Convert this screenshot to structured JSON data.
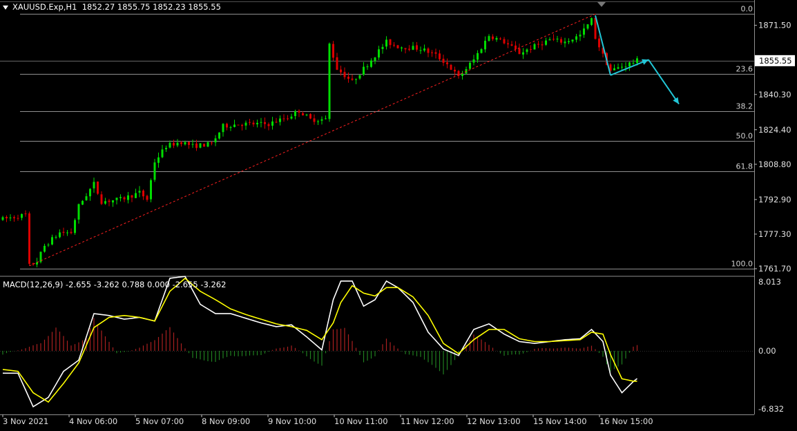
{
  "header": {
    "symbol": "XAUUSD.Exp,H1",
    "ohlc": "1852.27 1855.75 1852.23 1855.55"
  },
  "macd_header": {
    "label": "MACD(12,26,9) -2.655 -3.262 0.788 0.000 -2.655 -3.262"
  },
  "colors": {
    "background": "#000000",
    "bull": "#00dd00",
    "bear": "#dd0000",
    "grid": "#c0c0c0",
    "trendline": "#ff2020",
    "arrow": "#22c6d6",
    "macd_main": "#ffffff",
    "macd_signal": "#ffff00",
    "hist_up": "#aa2020",
    "hist_down": "#208020",
    "current_price_bg": "#ffffff"
  },
  "chart_data": [
    {
      "type": "candlestick",
      "name": "XAUUSD.Exp H1",
      "ylim": [
        1761.7,
        1877.0
      ],
      "y_ticks": [
        "1871.50",
        "1855.55",
        "1840.30",
        "1824.40",
        "1808.80",
        "1792.90",
        "1777.30",
        "1761.70"
      ],
      "current_price": "1855.55",
      "x_tick_labels": [
        "3 Nov 2021",
        "4 Nov 06:00",
        "5 Nov 07:00",
        "8 Nov 09:00",
        "9 Nov 10:00",
        "10 Nov 11:00",
        "11 Nov 12:00",
        "12 Nov 13:00",
        "15 Nov 14:00",
        "16 Nov 15:00"
      ],
      "price_path": [
        [
          0,
          1784
        ],
        [
          6,
          1786
        ],
        [
          7,
          1763
        ],
        [
          9,
          1765
        ],
        [
          11,
          1772
        ],
        [
          15,
          1778
        ],
        [
          18,
          1778
        ],
        [
          20,
          1790
        ],
        [
          24,
          1800
        ],
        [
          26,
          1792
        ],
        [
          31,
          1793
        ],
        [
          36,
          1796
        ],
        [
          38,
          1793
        ],
        [
          40,
          1810
        ],
        [
          43,
          1817
        ],
        [
          47,
          1819
        ],
        [
          50,
          1817
        ],
        [
          55,
          1818
        ],
        [
          58,
          1826
        ],
        [
          62,
          1827
        ],
        [
          67,
          1827
        ],
        [
          70,
          1827
        ],
        [
          75,
          1830
        ],
        [
          78,
          1833
        ],
        [
          81,
          1829
        ],
        [
          85,
          1829
        ],
        [
          86,
          1863
        ],
        [
          88,
          1852
        ],
        [
          92,
          1846
        ],
        [
          95,
          1852
        ],
        [
          98,
          1858
        ],
        [
          101,
          1864
        ],
        [
          104,
          1862
        ],
        [
          110,
          1861
        ],
        [
          114,
          1858
        ],
        [
          117,
          1854
        ],
        [
          120,
          1848
        ],
        [
          124,
          1856
        ],
        [
          128,
          1867
        ],
        [
          132,
          1864
        ],
        [
          136,
          1859
        ],
        [
          140,
          1862
        ],
        [
          144,
          1865
        ],
        [
          148,
          1864
        ],
        [
          152,
          1867
        ],
        [
          155,
          1874
        ],
        [
          156,
          1866
        ],
        [
          158,
          1858
        ],
        [
          160,
          1851
        ],
        [
          163,
          1853
        ],
        [
          167,
          1855.55
        ]
      ],
      "fibonacci": {
        "levels": [
          "0.0",
          "23.6",
          "38.2",
          "50.0",
          "61.8",
          "100.0"
        ],
        "prices": [
          1876.6,
          1849.5,
          1832.7,
          1819.2,
          1805.6,
          1761.7
        ]
      },
      "trendline": {
        "from": [
          7,
          1763
        ],
        "to": [
          156,
          1876.6
        ]
      },
      "arrows": [
        {
          "from": [
            156,
            1876
          ],
          "to": [
            160,
            1849
          ]
        },
        {
          "from": [
            160,
            1849
          ],
          "to": [
            170,
            1856
          ]
        },
        {
          "from": [
            170,
            1856
          ],
          "to": [
            178,
            1836
          ]
        }
      ]
    },
    {
      "type": "line",
      "name": "MACD(12,26,9)",
      "ylim": [
        -6.832,
        8.013
      ],
      "y_ticks": [
        "8.013",
        "0.00",
        "-6.832"
      ],
      "series": [
        {
          "name": "MACD",
          "values": [
            [
              0,
              -2.4
            ],
            [
              4,
              -2.4
            ],
            [
              8,
              -6.0
            ],
            [
              12,
              -5.0
            ],
            [
              16,
              -2.2
            ],
            [
              20,
              -1.0
            ],
            [
              24,
              4.0
            ],
            [
              28,
              3.8
            ],
            [
              32,
              3.4
            ],
            [
              36,
              3.6
            ],
            [
              40,
              3.2
            ],
            [
              44,
              7.8
            ],
            [
              48,
              8.0
            ],
            [
              52,
              5.0
            ],
            [
              56,
              4.0
            ],
            [
              60,
              4.0
            ],
            [
              64,
              3.5
            ],
            [
              68,
              3.0
            ],
            [
              72,
              2.6
            ],
            [
              76,
              2.8
            ],
            [
              80,
              1.5
            ],
            [
              84,
              0.1
            ],
            [
              87,
              5.5
            ],
            [
              89,
              7.5
            ],
            [
              92,
              7.5
            ],
            [
              95,
              4.8
            ],
            [
              98,
              5.5
            ],
            [
              101,
              7.5
            ],
            [
              104,
              6.8
            ],
            [
              108,
              5.2
            ],
            [
              112,
              2.0
            ],
            [
              116,
              0.2
            ],
            [
              120,
              -0.5
            ],
            [
              124,
              2.3
            ],
            [
              128,
              2.9
            ],
            [
              132,
              1.8
            ],
            [
              136,
              1.0
            ],
            [
              140,
              0.8
            ],
            [
              144,
              1.0
            ],
            [
              148,
              1.2
            ],
            [
              152,
              1.3
            ],
            [
              155,
              2.3
            ],
            [
              158,
              1.0
            ],
            [
              160,
              -2.6
            ],
            [
              163,
              -4.5
            ],
            [
              166,
              -3.3
            ],
            [
              168,
              -2.655
            ]
          ]
        },
        {
          "name": "Signal",
          "values": [
            [
              0,
              -2.0
            ],
            [
              4,
              -2.2
            ],
            [
              8,
              -4.5
            ],
            [
              12,
              -5.5
            ],
            [
              16,
              -3.5
            ],
            [
              20,
              -1.3
            ],
            [
              24,
              2.5
            ],
            [
              28,
              3.6
            ],
            [
              32,
              3.8
            ],
            [
              36,
              3.6
            ],
            [
              40,
              3.2
            ],
            [
              44,
              6.4
            ],
            [
              48,
              7.8
            ],
            [
              52,
              6.4
            ],
            [
              56,
              5.5
            ],
            [
              60,
              4.5
            ],
            [
              64,
              3.9
            ],
            [
              68,
              3.4
            ],
            [
              72,
              2.9
            ],
            [
              76,
              2.6
            ],
            [
              80,
              2.2
            ],
            [
              84,
              1.2
            ],
            [
              87,
              3.0
            ],
            [
              89,
              5.2
            ],
            [
              92,
              7.0
            ],
            [
              95,
              6.2
            ],
            [
              98,
              5.9
            ],
            [
              101,
              6.8
            ],
            [
              104,
              6.8
            ],
            [
              108,
              5.8
            ],
            [
              112,
              3.8
            ],
            [
              116,
              0.8
            ],
            [
              120,
              -0.3
            ],
            [
              124,
              1.2
            ],
            [
              128,
              2.3
            ],
            [
              132,
              2.3
            ],
            [
              136,
              1.3
            ],
            [
              140,
              1.0
            ],
            [
              144,
              1.0
            ],
            [
              148,
              1.1
            ],
            [
              152,
              1.2
            ],
            [
              155,
              2.0
            ],
            [
              158,
              1.8
            ],
            [
              160,
              -0.4
            ],
            [
              163,
              -3.0
            ],
            [
              166,
              -3.262
            ],
            [
              168,
              -3.262
            ]
          ]
        }
      ],
      "histogram": [
        [
          0,
          -0.4
        ],
        [
          10,
          0.8
        ],
        [
          14,
          2.5
        ],
        [
          18,
          0.6
        ],
        [
          22,
          1.3
        ],
        [
          24,
          3.5
        ],
        [
          30,
          -0.3
        ],
        [
          36,
          0.3
        ],
        [
          40,
          1.2
        ],
        [
          44,
          2.5
        ],
        [
          50,
          -0.8
        ],
        [
          56,
          -1.2
        ],
        [
          60,
          -0.5
        ],
        [
          64,
          -0.6
        ],
        [
          68,
          -0.4
        ],
        [
          72,
          0.2
        ],
        [
          76,
          0.6
        ],
        [
          80,
          -0.6
        ],
        [
          84,
          -1.6
        ],
        [
          87,
          2.3
        ],
        [
          90,
          2.5
        ],
        [
          95,
          -1.2
        ],
        [
          98,
          -0.6
        ],
        [
          101,
          1.3
        ],
        [
          106,
          -0.4
        ],
        [
          110,
          -0.6
        ],
        [
          116,
          -2.5
        ],
        [
          120,
          -0.5
        ],
        [
          124,
          1.8
        ],
        [
          128,
          0.6
        ],
        [
          132,
          -0.5
        ],
        [
          136,
          -0.4
        ],
        [
          140,
          0.2
        ],
        [
          144,
          0.3
        ],
        [
          152,
          0.3
        ],
        [
          155,
          0.5
        ],
        [
          158,
          -0.6
        ],
        [
          160,
          -2.2
        ],
        [
          163,
          -1.5
        ],
        [
          166,
          0.5
        ],
        [
          168,
          0.788
        ]
      ]
    }
  ]
}
